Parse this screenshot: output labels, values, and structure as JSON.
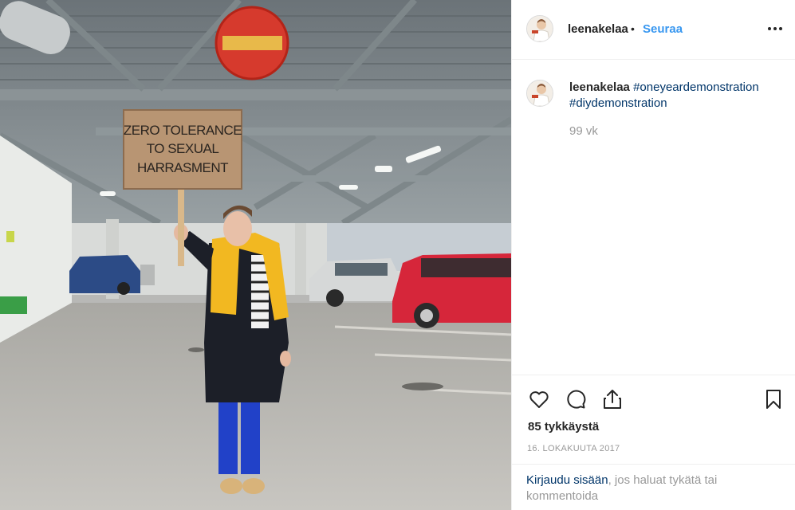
{
  "photo": {
    "sign_lines": [
      "ZERO TOLERANCE",
      "TO SEXUAL",
      "HARRASMENT"
    ]
  },
  "header": {
    "username": "leenakelaa",
    "separator": "•",
    "follow_label": "Seuraa",
    "avatar_icon": "profile-avatar",
    "more_icon": "more-dots-icon"
  },
  "caption": {
    "username": "leenakelaa",
    "hashtags": [
      "#oneyeardemonstration",
      "#diydemonstration"
    ],
    "age": "99 vk"
  },
  "actions": {
    "icons": [
      "heart-icon",
      "comment-icon",
      "share-icon",
      "bookmark-icon"
    ],
    "likes": "85 tykkäystä",
    "date": "16. LOKAKUUTA 2017"
  },
  "login": {
    "link_label": "Kirjaudu sisään",
    "rest_text": ", jos haluat tykätä tai kommentoida"
  },
  "colors": {
    "link": "#3897f0",
    "hashtag": "#003569",
    "muted": "#999999",
    "text": "#262626"
  }
}
